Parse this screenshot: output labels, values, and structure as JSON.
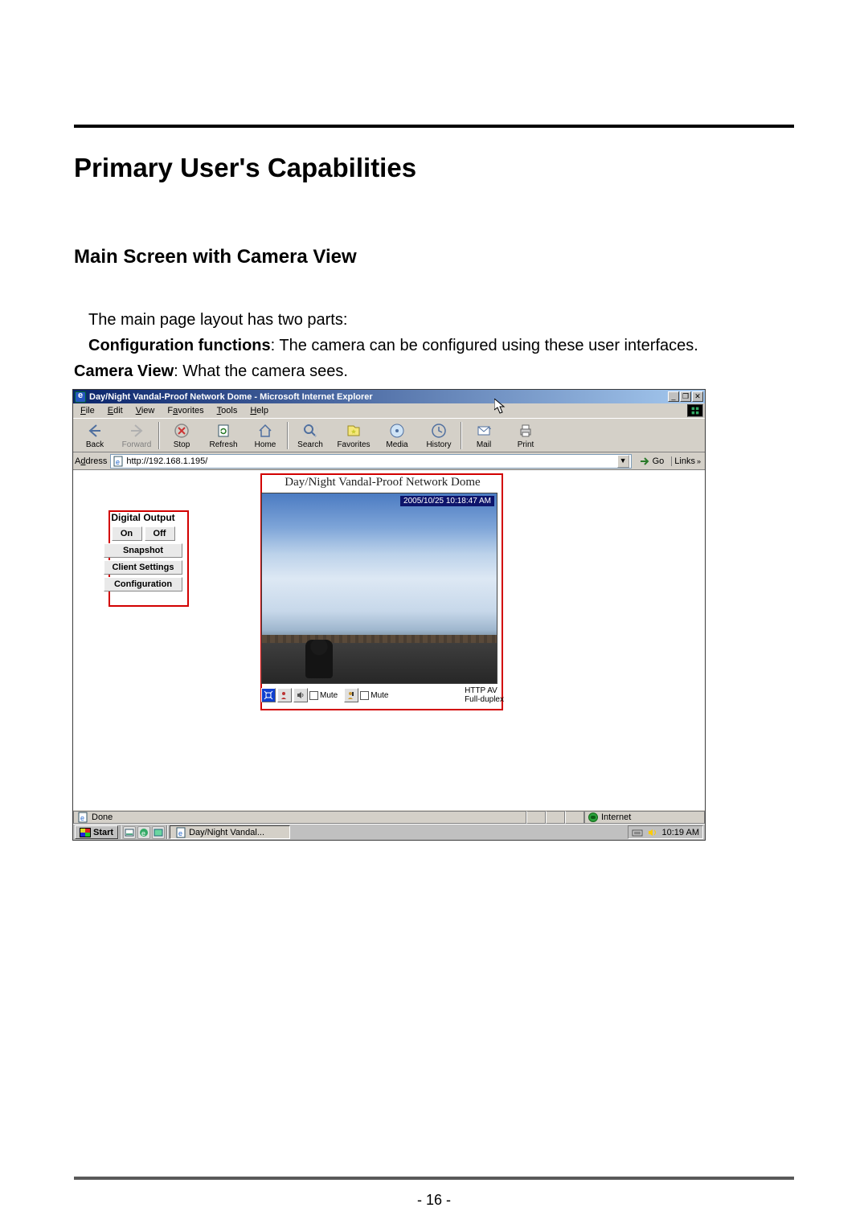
{
  "doc": {
    "h1": "Primary User's Capabilities",
    "h2": "Main Screen with Camera View",
    "p1": "The main page layout has two parts:",
    "p2a": "Configuration functions",
    "p2b": ": The camera can be configured using these user interfaces.",
    "p3a": "Camera View",
    "p3b": ": What the camera sees.",
    "page_num": "- 16 -"
  },
  "ie": {
    "title": "Day/Night Vandal-Proof Network Dome - Microsoft Internet Explorer",
    "window_buttons": {
      "min": "_",
      "max": "❐",
      "close": "✕"
    },
    "menus": [
      {
        "label": "File",
        "u": "F"
      },
      {
        "label": "Edit",
        "u": "E"
      },
      {
        "label": "View",
        "u": "V"
      },
      {
        "label": "Favorites",
        "u": "a"
      },
      {
        "label": "Tools",
        "u": "T"
      },
      {
        "label": "Help",
        "u": "H"
      }
    ],
    "toolbar": [
      {
        "name": "back",
        "label": "Back",
        "disabled": false
      },
      {
        "name": "forward",
        "label": "Forward",
        "disabled": true
      },
      {
        "name": "stop",
        "label": "Stop"
      },
      {
        "name": "refresh",
        "label": "Refresh"
      },
      {
        "name": "home",
        "label": "Home"
      },
      {
        "name": "search",
        "label": "Search"
      },
      {
        "name": "favorites",
        "label": "Favorites"
      },
      {
        "name": "media",
        "label": "Media"
      },
      {
        "name": "history",
        "label": "History"
      },
      {
        "name": "mail",
        "label": "Mail"
      },
      {
        "name": "print",
        "label": "Print"
      }
    ],
    "address_label": "Address",
    "address_value": "http://192.168.1.195/",
    "go_label": "Go",
    "links_label": "Links",
    "status_left": "Done",
    "status_zone": "Internet"
  },
  "page_content": {
    "camera_title": "Day/Night Vandal-Proof Network Dome",
    "timestamp": "2005/10/25 10:18:47 AM",
    "sidebar": {
      "title": "Digital Output",
      "on": "On",
      "off": "Off",
      "snapshot": "Snapshot",
      "client_settings": "Client Settings",
      "configuration": "Configuration"
    },
    "controls": {
      "mute1": "Mute",
      "mute2": "Mute",
      "proto_top": "HTTP  AV",
      "proto_bottom": "Full-duplex"
    }
  },
  "taskbar": {
    "start": "Start",
    "task": "Day/Night Vandal...",
    "clock": "10:19 AM"
  }
}
